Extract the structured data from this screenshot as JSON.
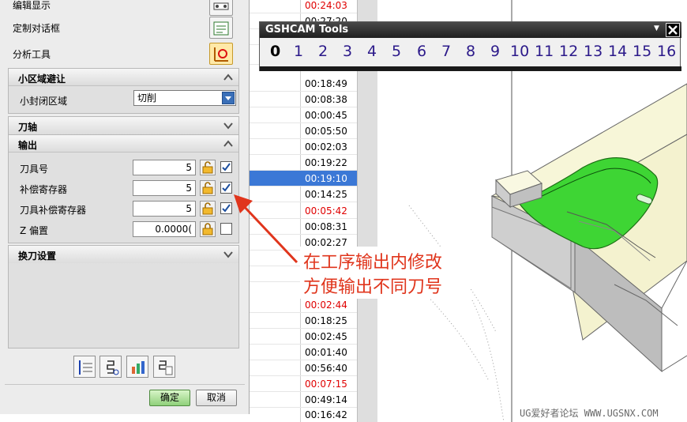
{
  "dialog": {
    "tool_rows": [
      {
        "label": "编辑显示"
      },
      {
        "label": "定制对话框"
      },
      {
        "label": "分析工具"
      }
    ],
    "groups": {
      "region": {
        "title": "小区域避让",
        "row_label": "小封闭区域",
        "select_value": "切削"
      },
      "axis": {
        "title": "刀轴"
      },
      "output": {
        "title": "输出",
        "rows": [
          {
            "label": "刀具号",
            "value": "5",
            "checked": true
          },
          {
            "label": "补偿寄存器",
            "value": "5",
            "checked": true
          },
          {
            "label": "刀具补偿寄存器",
            "value": "5",
            "checked": true
          },
          {
            "label": "Z 偏置",
            "value": "0.0000(",
            "checked": false
          }
        ]
      },
      "toolchange": {
        "title": "换刀设置"
      }
    },
    "ok_label": "确定",
    "cancel_label": "取消"
  },
  "time_list": [
    {
      "time": "00:24:03",
      "red": true
    },
    {
      "time": "00:27:20",
      "red": false
    },
    {
      "time": "",
      "red": false
    },
    {
      "time": "",
      "red": false
    },
    {
      "time": "00:18:49",
      "red": false
    },
    {
      "time": "00:08:38",
      "red": false
    },
    {
      "time": "00:00:45",
      "red": false
    },
    {
      "time": "00:05:50",
      "red": false
    },
    {
      "time": "00:02:03",
      "red": false
    },
    {
      "time": "00:19:22",
      "red": false
    },
    {
      "time": "00:19:10",
      "red": false,
      "selected": true
    },
    {
      "time": "00:14:25",
      "red": false
    },
    {
      "time": "00:05:42",
      "red": true
    },
    {
      "time": "00:08:31",
      "red": false
    },
    {
      "time": "00:02:27",
      "red": false
    },
    {
      "time": "",
      "red": false
    },
    {
      "time": "",
      "red": false
    },
    {
      "time": "00:02:44",
      "red": true
    },
    {
      "time": "00:18:25",
      "red": false
    },
    {
      "time": "00:02:45",
      "red": false
    },
    {
      "time": "00:01:40",
      "red": false
    },
    {
      "time": "00:56:40",
      "red": false
    },
    {
      "time": "00:07:15",
      "red": true
    },
    {
      "time": "00:49:14",
      "red": false
    },
    {
      "time": "00:16:42",
      "red": false
    }
  ],
  "gshcam": {
    "title": "GSHCAM Tools",
    "numbers": [
      "0",
      "1",
      "2",
      "3",
      "4",
      "5",
      "6",
      "7",
      "8",
      "9",
      "10",
      "11",
      "12",
      "13",
      "14",
      "15",
      "16"
    ]
  },
  "annotation": {
    "line1": "在工序输出内修改",
    "line2": "方便输出不同刀号"
  },
  "watermark": "UG爱好者论坛 WWW.UGSNX.COM",
  "colors": {
    "accent_blue": "#3b78d6",
    "red_time": "#e00000",
    "annotation": "#e0351c",
    "part_green": "#39d62e"
  }
}
